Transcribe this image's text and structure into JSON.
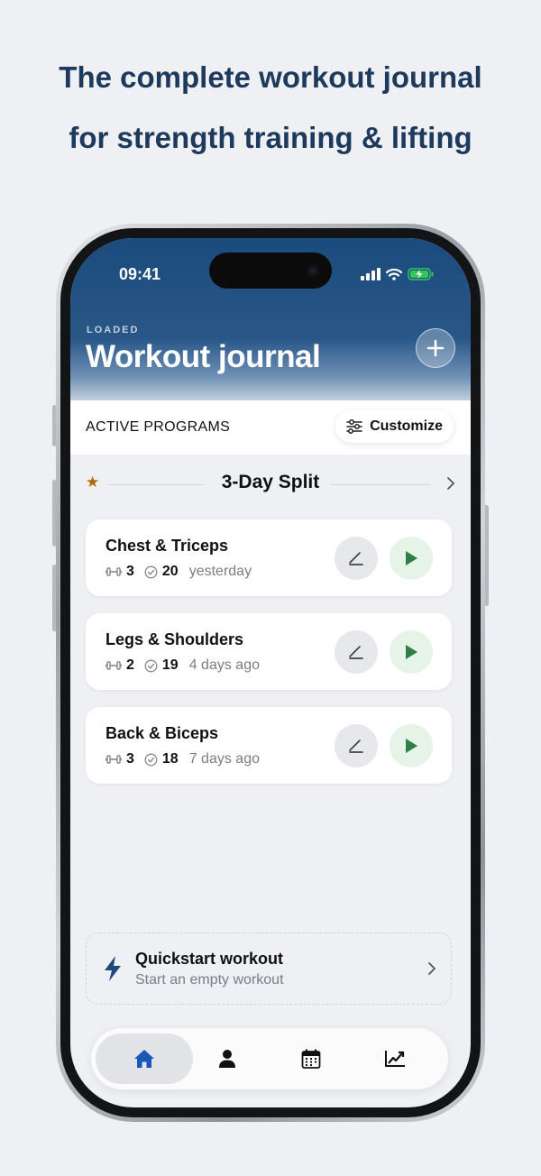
{
  "marketing": {
    "headline_line1": "The complete workout journal",
    "headline_line2": "for strength training & lifting",
    "text_color": "#1d3a5c"
  },
  "status_bar": {
    "time": "09:41",
    "icons": [
      "cellular-signal-icon",
      "wifi-icon",
      "battery-charging-icon"
    ],
    "battery_color": "#34c759"
  },
  "header": {
    "eyebrow": "LOADED",
    "title": "Workout journal",
    "add_icon": "plus-icon",
    "bg_color": "#1b4a7c"
  },
  "programs_bar": {
    "label": "ACTIVE PROGRAMS",
    "customize_label": "Customize",
    "customize_icon": "sliders-icon"
  },
  "program": {
    "name": "3-Day Split",
    "star_icon": "star-icon",
    "star_color": "#b06a0a"
  },
  "workouts": [
    {
      "name": "Chest & Triceps",
      "exercises": "3",
      "sets": "20",
      "last_done": "yesterday"
    },
    {
      "name": "Legs & Shoulders",
      "exercises": "2",
      "sets": "19",
      "last_done": "4 days ago"
    },
    {
      "name": "Back & Biceps",
      "exercises": "3",
      "sets": "18",
      "last_done": "7 days ago"
    }
  ],
  "workout_icons": {
    "exercises": "dumbbell-icon",
    "sets": "check-circle-icon",
    "edit": "pencil-icon",
    "start": "play-icon",
    "play_color": "#2f7d47"
  },
  "quickstart": {
    "title": "Quickstart workout",
    "subtitle": "Start an empty workout",
    "icon": "lightning-bolt-icon",
    "icon_color": "#1b4a7c"
  },
  "tabbar": {
    "tabs": [
      {
        "name": "home",
        "icon": "home-icon",
        "active": true
      },
      {
        "name": "profile",
        "icon": "person-icon",
        "active": false
      },
      {
        "name": "calendar",
        "icon": "calendar-icon",
        "active": false
      },
      {
        "name": "progress",
        "icon": "chart-line-icon",
        "active": false
      }
    ],
    "active_color": "#1a56b8"
  }
}
